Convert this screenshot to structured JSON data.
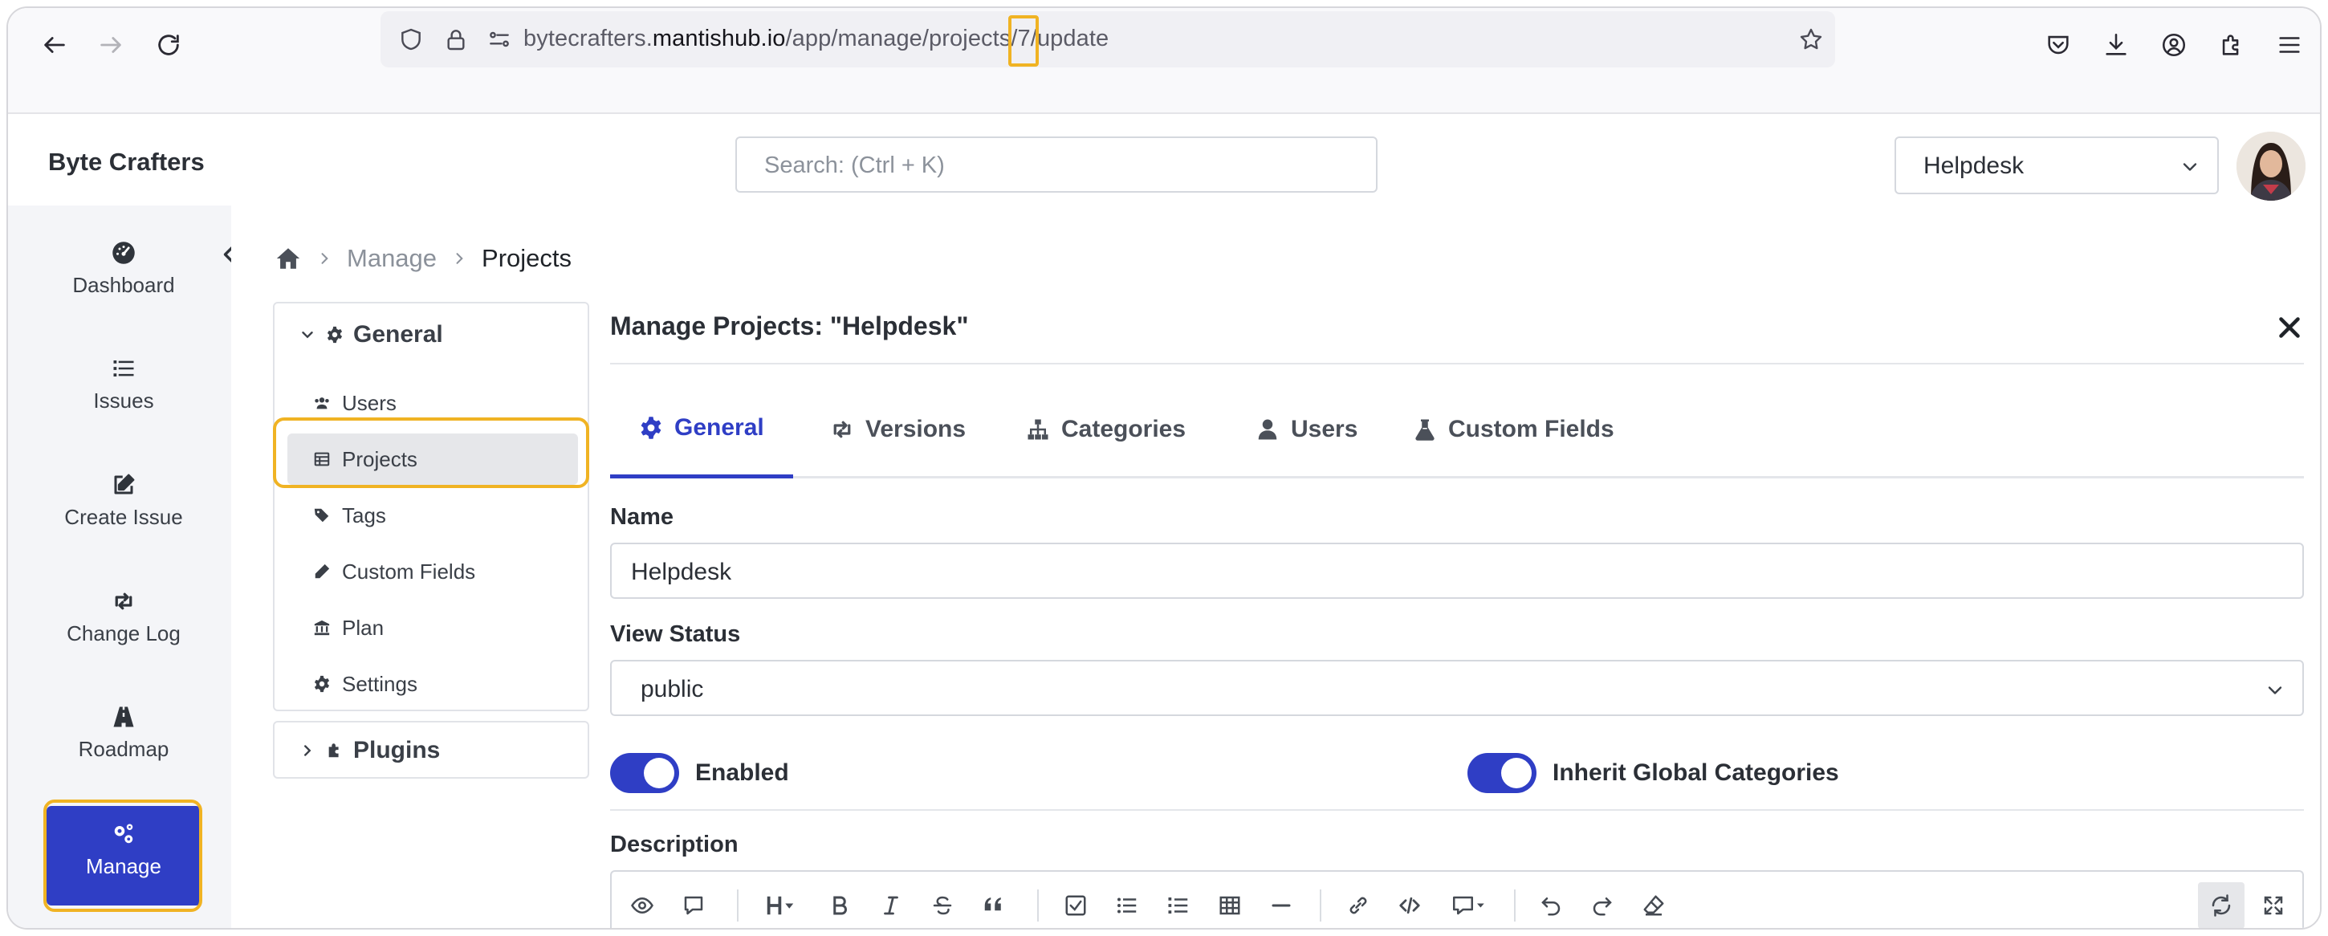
{
  "browser": {
    "url_prefix": "bytecrafters.",
    "url_domain": "mantishub.io",
    "url_path": "/app/manage/projects/7/update"
  },
  "header": {
    "brand": "Byte Crafters",
    "search_placeholder": "Search: (Ctrl + K)",
    "project_selected": "Helpdesk"
  },
  "sidebar": {
    "items": [
      {
        "label": "Dashboard",
        "icon": "gauge-icon"
      },
      {
        "label": "Issues",
        "icon": "list-icon"
      },
      {
        "label": "Create Issue",
        "icon": "edit-icon"
      },
      {
        "label": "Change Log",
        "icon": "retweet-icon"
      },
      {
        "label": "Roadmap",
        "icon": "road-icon"
      },
      {
        "label": "Manage",
        "icon": "cogs-icon",
        "active": true
      }
    ]
  },
  "breadcrumb": {
    "items": [
      "Manage",
      "Projects"
    ]
  },
  "subnav": {
    "general_label": "General",
    "items": [
      {
        "label": "Users",
        "icon": "users-icon"
      },
      {
        "label": "Projects",
        "icon": "table-icon",
        "active": true
      },
      {
        "label": "Tags",
        "icon": "tags-icon"
      },
      {
        "label": "Custom Fields",
        "icon": "pencil-icon"
      },
      {
        "label": "Plan",
        "icon": "bank-icon"
      },
      {
        "label": "Settings",
        "icon": "gear-icon"
      }
    ],
    "plugins_label": "Plugins"
  },
  "panel": {
    "title": "Manage Projects: \"Helpdesk\"",
    "tabs": [
      {
        "label": "General",
        "icon": "gear-icon",
        "active": true
      },
      {
        "label": "Versions",
        "icon": "retweet-icon"
      },
      {
        "label": "Categories",
        "icon": "sitemap-icon"
      },
      {
        "label": "Users",
        "icon": "user-icon"
      },
      {
        "label": "Custom Fields",
        "icon": "flask-icon"
      }
    ],
    "name_label": "Name",
    "name_value": "Helpdesk",
    "view_status_label": "View Status",
    "view_status_value": "public",
    "enabled_label": "Enabled",
    "enabled_on": true,
    "inherit_label": "Inherit Global Categories",
    "inherit_on": true,
    "description_label": "Description"
  },
  "colors": {
    "accent": "#2f3ec5",
    "highlight": "#f0b323"
  }
}
